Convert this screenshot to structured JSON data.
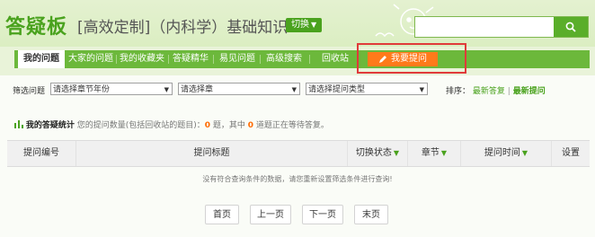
{
  "header": {
    "app_title": "答疑板",
    "page_title": "[高效定制]（内科学）基础知识",
    "switch_label": "切换",
    "search_placeholder": ""
  },
  "nav": {
    "items": [
      {
        "label": "我的问题",
        "active": true
      },
      {
        "label": "大家的问题"
      },
      {
        "label": "我的收藏夹"
      },
      {
        "label": "答疑精华"
      },
      {
        "label": "易见问题"
      },
      {
        "label": "高级搜索"
      },
      {
        "label": "回收站"
      }
    ],
    "ask_button": "我要提问"
  },
  "filters": {
    "label": "筛选问题",
    "year": "请选择章节年份",
    "chapter": "请选择章",
    "type": "请选择提问类型"
  },
  "sort": {
    "label": "排序：",
    "option1": "最新答复",
    "separator": "|",
    "option2": "最新提问"
  },
  "stats": {
    "title": "我的答疑统计",
    "text1": "您的提问数量(包括回收站的题目)：",
    "total": "0",
    "text2": " 题，其中 ",
    "pending": "0",
    "text3": " 道题正在等待答复。"
  },
  "table": {
    "headers": [
      "提问编号",
      "提问标题",
      "切换状态",
      "章节",
      "提问时间",
      "设置"
    ],
    "empty_message": "没有符合查询条件的数据，请您重新设置筛选条件进行查询!"
  },
  "pager": {
    "first": "首页",
    "prev": "上一页",
    "next": "下一页",
    "last": "末页"
  },
  "colors": {
    "brand_green": "#4aa21e",
    "nav_green": "#6cb83b",
    "ask_orange": "#ff7a1a",
    "highlight_red": "#e03a3a"
  }
}
